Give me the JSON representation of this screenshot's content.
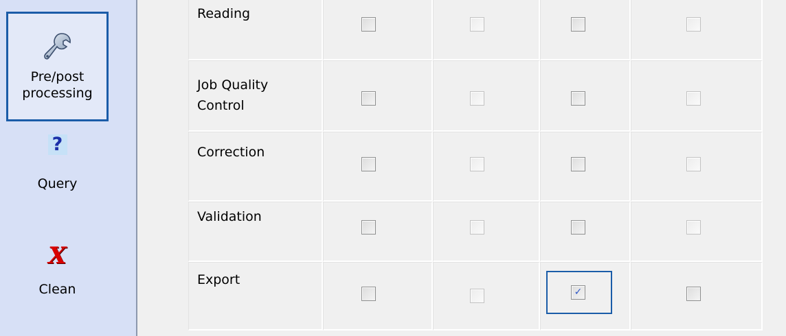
{
  "sidebar": {
    "items": [
      {
        "label": "Pre/post\nprocessing",
        "icon": "wrench-icon",
        "selected": true
      },
      {
        "label": "Query",
        "icon": "question-mark-icon",
        "selected": false
      },
      {
        "label": "Clean",
        "icon": "red-x-icon",
        "selected": false
      }
    ]
  },
  "colors": {
    "sidebar_bg": "#d7e0f6",
    "selection_border": "#1a5ca8",
    "checkmark": "#2f58c6",
    "query_icon_bg": "#c6e1f7",
    "clean_icon": "#d90000"
  },
  "grid": {
    "rows": [
      {
        "label": "Reading",
        "checks": [
          false,
          false,
          false,
          false
        ]
      },
      {
        "label": "Job Quality\nControl",
        "checks": [
          false,
          false,
          false,
          false
        ]
      },
      {
        "label": "Correction",
        "checks": [
          false,
          false,
          false,
          false
        ]
      },
      {
        "label": "Validation",
        "checks": [
          false,
          false,
          false,
          false
        ]
      },
      {
        "label": "Export",
        "checks": [
          false,
          false,
          true,
          false
        ]
      }
    ]
  }
}
